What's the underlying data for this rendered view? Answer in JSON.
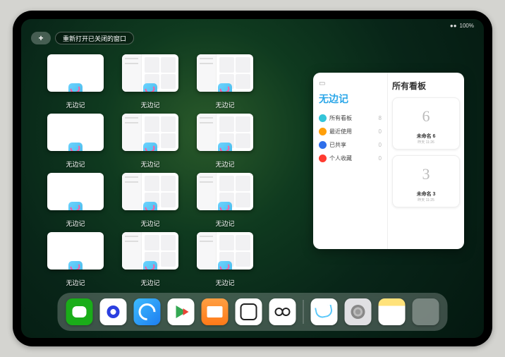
{
  "status": {
    "battery": "100%",
    "wifi": "●●"
  },
  "top": {
    "plus": "+",
    "reopen_label": "重新打开已关闭的窗口"
  },
  "app_windows": [
    {
      "label": "无边记",
      "variant": "blank"
    },
    {
      "label": "无边记",
      "variant": "detail"
    },
    {
      "label": "无边记",
      "variant": "detail"
    },
    {
      "label": "无边记",
      "variant": "blank"
    },
    {
      "label": "无边记",
      "variant": "detail"
    },
    {
      "label": "无边记",
      "variant": "detail"
    },
    {
      "label": "无边记",
      "variant": "blank"
    },
    {
      "label": "无边记",
      "variant": "detail"
    },
    {
      "label": "无边记",
      "variant": "detail"
    },
    {
      "label": "无边记",
      "variant": "blank"
    },
    {
      "label": "无边记",
      "variant": "detail"
    },
    {
      "label": "无边记",
      "variant": "detail"
    }
  ],
  "preview": {
    "left_title": "无边记",
    "rows": [
      {
        "icon_color": "#34c5d9",
        "label": "所有看板",
        "count": "8"
      },
      {
        "icon_color": "#ff9f0a",
        "label": "最近使用",
        "count": "0"
      },
      {
        "icon_color": "#2f6fea",
        "label": "已共享",
        "count": "0"
      },
      {
        "icon_color": "#ff3b30",
        "label": "个人收藏",
        "count": "0"
      }
    ],
    "right_title": "所有看板",
    "boards": [
      {
        "glyph": "6",
        "label": "未命名 6",
        "sub": "昨天 11:26"
      },
      {
        "glyph": "3",
        "label": "未命名 3",
        "sub": "昨天 11:25"
      }
    ]
  },
  "dock": {
    "items": [
      {
        "name": "wechat-icon"
      },
      {
        "name": "quark-icon"
      },
      {
        "name": "browser-icon"
      },
      {
        "name": "play-icon"
      },
      {
        "name": "books-icon"
      },
      {
        "name": "dice-icon"
      },
      {
        "name": "link-icon"
      }
    ],
    "recent": [
      {
        "name": "freeform-icon"
      },
      {
        "name": "settings-icon"
      },
      {
        "name": "notes-icon"
      },
      {
        "name": "app-library-icon"
      }
    ]
  }
}
